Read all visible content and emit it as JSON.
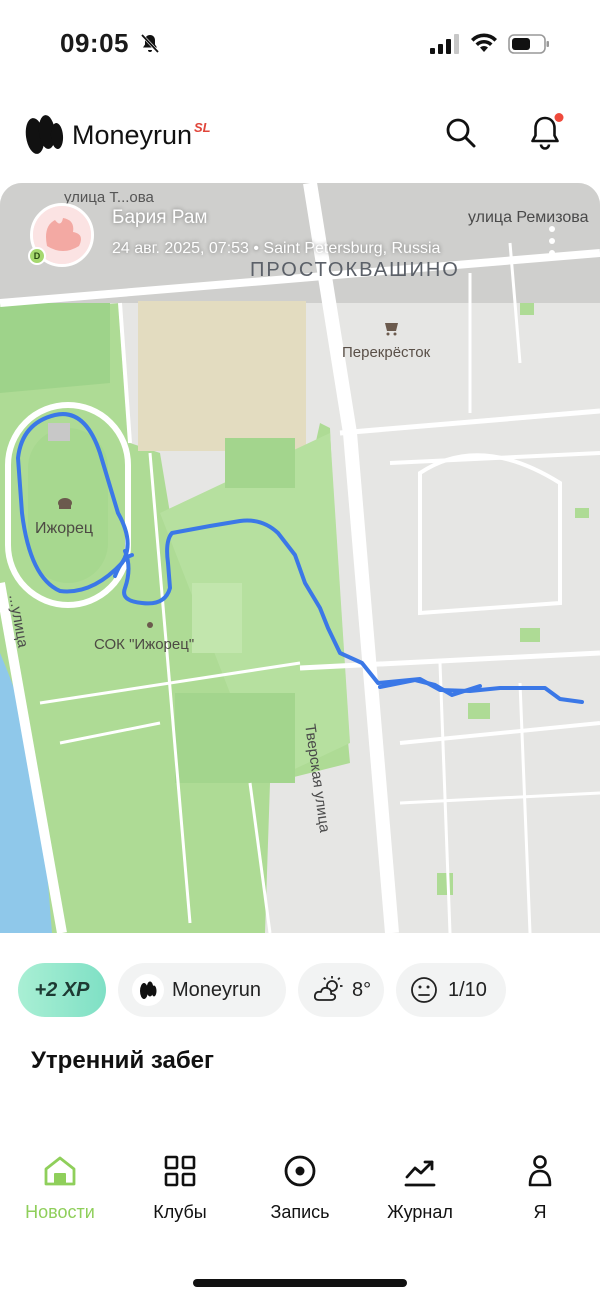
{
  "status_bar": {
    "time": "09:05",
    "icons": [
      "bell-slash-icon",
      "signal-icon",
      "wifi-icon",
      "battery-icon"
    ]
  },
  "header": {
    "app_name": "Moneyrun",
    "app_suffix": "SL",
    "suffix_color": "#e0453a",
    "icons": [
      "search-icon",
      "bell-icon"
    ],
    "notification_dot_color": "#ef4a3c"
  },
  "post": {
    "author": "Бария Рам",
    "author_badge": "D",
    "meta": "24 авг. 2025, 07:53 • Saint Petersburg, Russia",
    "map_labels": {
      "street_top_left": "улица Т...ова",
      "street_remizova": "улица Ремизова",
      "district": "ПРОСТОКВАШИНО",
      "shop": "Перекрёсток",
      "stadium": "Ижорец",
      "sports_complex": "СОК \"Ижорец\"",
      "tverskaya": "Тверская улица",
      "street_left": "...улица"
    },
    "route_color": "#3b78e7",
    "title": "Утренний забег"
  },
  "chips": {
    "xp": "+2 XP",
    "club": "Moneyrun",
    "temperature": "8°",
    "effort": "1/10"
  },
  "nav": {
    "items": [
      {
        "label": "Новости",
        "icon": "home-icon"
      },
      {
        "label": "Клубы",
        "icon": "grid-icon"
      },
      {
        "label": "Запись",
        "icon": "record-icon"
      },
      {
        "label": "Журнал",
        "icon": "chart-icon"
      },
      {
        "label": "Я",
        "icon": "profile-icon"
      }
    ],
    "active": "Новости",
    "active_color": "#8fcf5b"
  }
}
